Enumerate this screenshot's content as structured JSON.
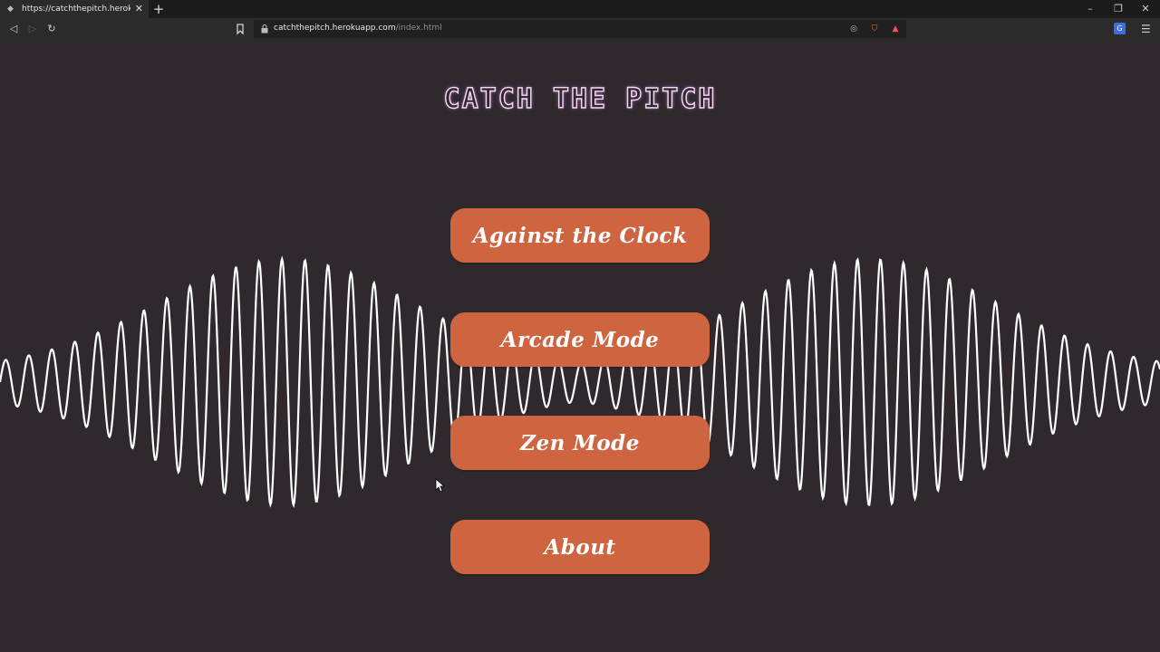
{
  "browser": {
    "tab_title": "https://catchthepitch.herokuapp.com/index.html",
    "url_host": "catchthepitch.herokuapp.com",
    "url_path": "/index.html"
  },
  "page": {
    "title": "CATCH THE PITCH",
    "menu": [
      {
        "id": "against-the-clock",
        "label": "Against the Clock"
      },
      {
        "id": "arcade-mode",
        "label": "Arcade Mode"
      },
      {
        "id": "zen-mode",
        "label": "Zen Mode"
      },
      {
        "id": "about",
        "label": "About"
      }
    ]
  },
  "colors": {
    "background": "#2f282d",
    "button": "#cf6440",
    "wave": "#ffffff",
    "title_outline": "#f7d7f4"
  }
}
